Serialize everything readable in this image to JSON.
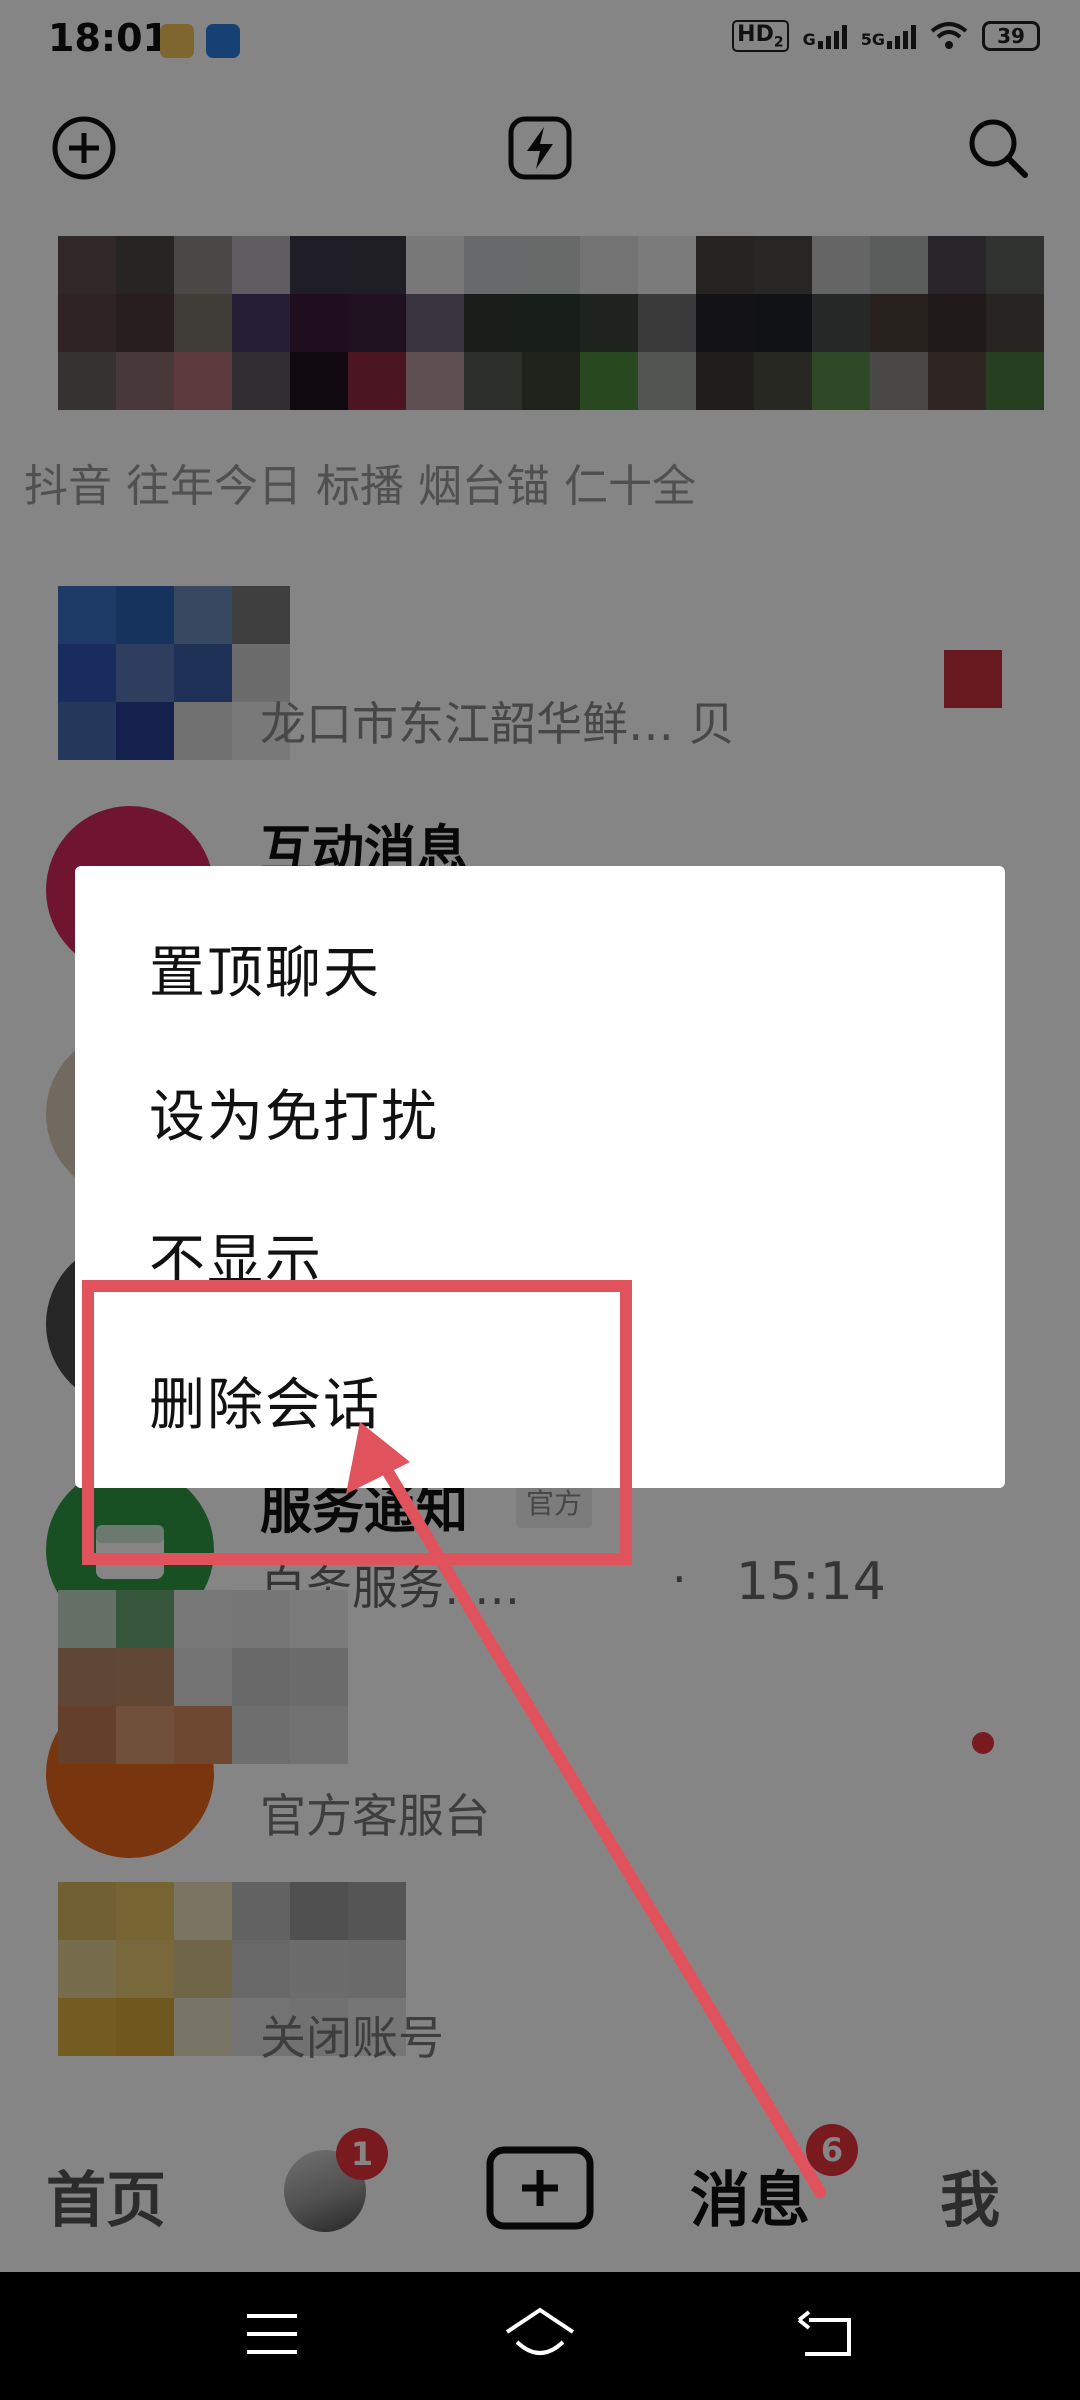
{
  "status_bar": {
    "time": "18:01",
    "network_hd": "HD",
    "network_sub": "2",
    "network_g": "G",
    "network_5g": "5G",
    "battery": "39"
  },
  "top_bar": {
    "icons": [
      "add-circle-icon",
      "lightning-icon",
      "search-icon"
    ]
  },
  "list": {
    "row1_text": "抖音 往年今日 标播 烟台锚 仁十全",
    "row2_sub": "龙口市东江韶华鲜… 贝",
    "interaction_title": "互动消息",
    "service_title": "服务通知",
    "service_tag": "官方",
    "service_sub": "自务服务: …",
    "service_dot": "·",
    "service_time": "15:14",
    "official_sub": "官方客服台",
    "last_sub": "关闭账号"
  },
  "context_menu": {
    "items": [
      "置顶聊天",
      "设为免打扰",
      "不显示",
      "删除会话"
    ]
  },
  "bottom_nav": {
    "home": "首页",
    "friends_badge": "1",
    "messages": "消息",
    "messages_badge": "6",
    "me": "我"
  },
  "colors": {
    "accent": "#e0525c",
    "badge": "#e8323c",
    "service_green": "#2e9a45",
    "official_orange": "#e8661c"
  }
}
